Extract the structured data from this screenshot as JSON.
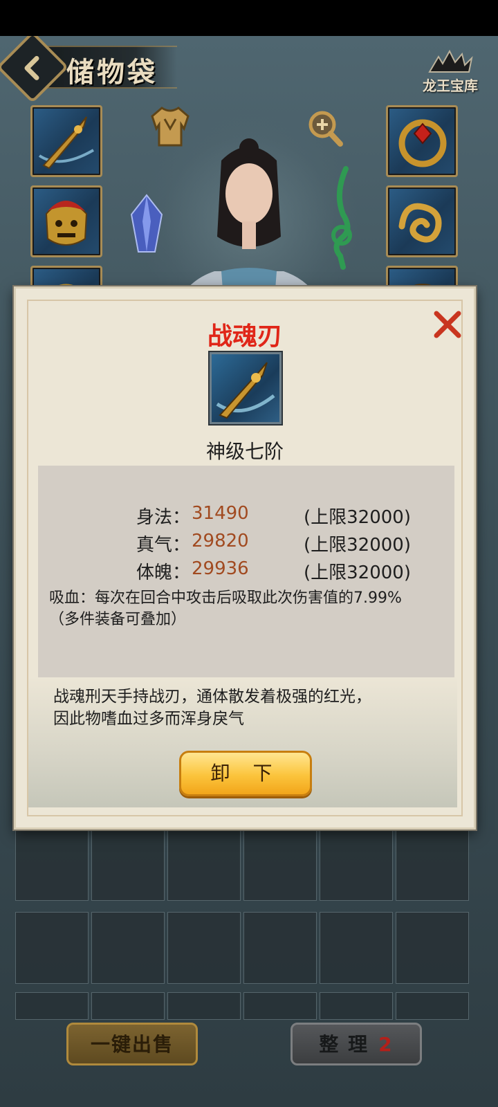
{
  "header": {
    "title": "储物袋",
    "logo_text": "龙王宝库"
  },
  "popup": {
    "item_name": "战魂刃",
    "grade": "神级七阶",
    "stats": [
      {
        "label": "身法：",
        "value": "31490",
        "cap": "(上限32000)"
      },
      {
        "label": "真气：",
        "value": "29820",
        "cap": "(上限32000)"
      },
      {
        "label": "体魄：",
        "value": "29936",
        "cap": "(上限32000)"
      }
    ],
    "lifesteal_line1": "吸血：每次在回合中攻击后吸取此次伤害值的7.99%",
    "lifesteal_line2": "（多件装备可叠加）",
    "lore_line1": "战魂刑天手持战刃，通体散发着极强的红光，",
    "lore_line2": "因此物嗜血过多而浑身戾气",
    "unequip_label": "卸 下",
    "colors": {
      "name": "#e02618",
      "stat_value": "#a14a20",
      "button": "#fbc43c"
    }
  },
  "footer": {
    "sell_label": "一键出售",
    "sort_label": "整 理",
    "sort_count": "2"
  },
  "equipment_slots_left": [
    "sword-icon",
    "lion-helmet-icon",
    "armor-icon"
  ],
  "equipment_slots_right": [
    "ring-icon",
    "jade-ornament-icon",
    "amulet-icon"
  ],
  "icons": {
    "back": "chevron-left-icon",
    "close": "close-icon",
    "armor_tab": "armor-tab-icon",
    "zoom": "zoom-in-icon"
  }
}
